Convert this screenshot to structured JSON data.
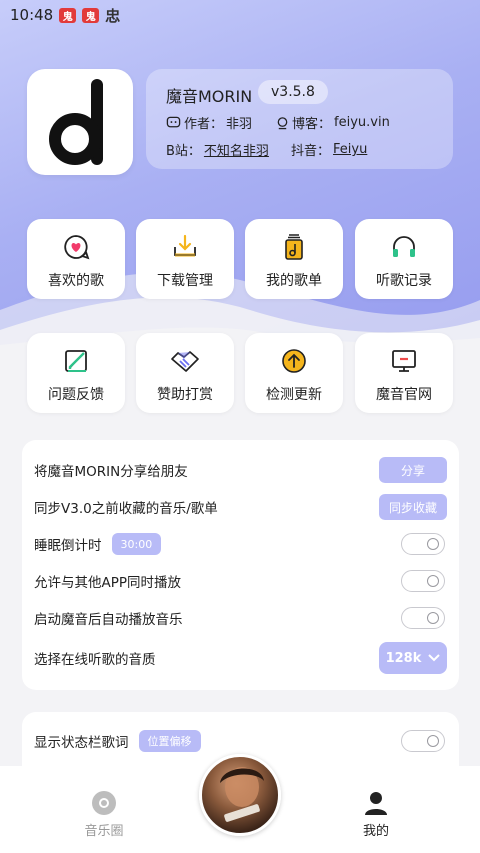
{
  "status_bar": {
    "time": "10:48",
    "chip1": "鬼",
    "chip2": "鬼",
    "icon3": "忠"
  },
  "app": {
    "name": "魔音MORIN",
    "version": "v3.5.8",
    "author_label": "作者：",
    "author": "非羽",
    "blog_label": "博客：",
    "blog": "feiyu.vin",
    "bilibili_label": "B站：",
    "bilibili": "不知名非羽",
    "douyin_label": "抖音：",
    "douyin": "Feiyu"
  },
  "tiles_row1": [
    {
      "label": "喜欢的歌",
      "icon": "heart-bubble-icon"
    },
    {
      "label": "下载管理",
      "icon": "download-icon"
    },
    {
      "label": "我的歌单",
      "icon": "playlist-icon"
    },
    {
      "label": "听歌记录",
      "icon": "headphones-icon"
    }
  ],
  "tiles_row2": [
    {
      "label": "问题反馈",
      "icon": "feedback-icon"
    },
    {
      "label": "赞助打赏",
      "icon": "handshake-icon"
    },
    {
      "label": "检测更新",
      "icon": "update-icon"
    },
    {
      "label": "魔音官网",
      "icon": "monitor-icon"
    }
  ],
  "settings": {
    "share_text": "将魔音MORIN分享给朋友",
    "share_btn": "分享",
    "sync_text": "同步V3.0之前收藏的音乐/歌单",
    "sync_btn": "同步收藏",
    "sleep_text": "睡眠倒计时",
    "sleep_value": "30:00",
    "allow_text": "允许与其他APP同时播放",
    "autoplay_text": "启动魔音后自动播放音乐",
    "quality_text": "选择在线听歌的音质",
    "quality_value": "128k"
  },
  "settings2": {
    "lyrics_text": "显示状态栏歌词",
    "offset_btn": "位置偏移"
  },
  "tabbar": {
    "left_label": "音乐圈",
    "right_label": "我的"
  },
  "colors": {
    "accent": "#b8bbf7",
    "hero_top": "#c7cdfa",
    "hero_bottom": "#959bef"
  }
}
